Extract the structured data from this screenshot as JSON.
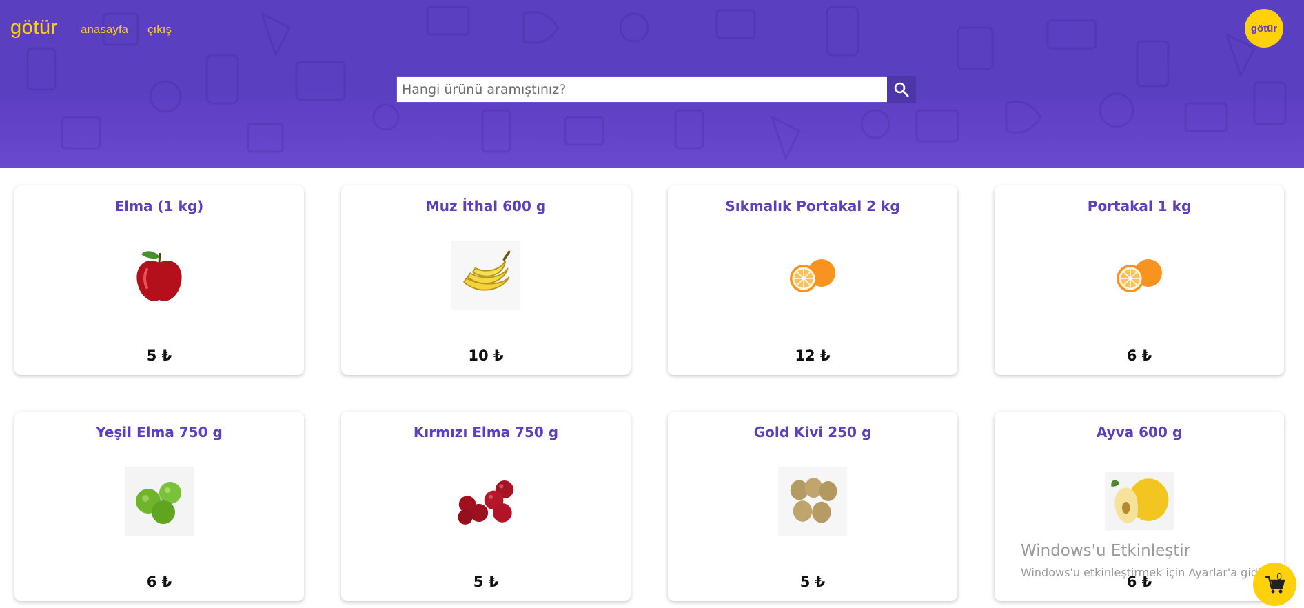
{
  "header": {
    "logo": "götür",
    "nav": {
      "home": "anasayfa",
      "logout": "çıkış"
    },
    "badge": "götür"
  },
  "search": {
    "placeholder": "Hangi ürünü aramıştınız?",
    "value": ""
  },
  "products": [
    {
      "name": "Elma (1 kg)",
      "price": "5 ₺",
      "image": "red-apple-icon"
    },
    {
      "name": "Muz İthal 600 g",
      "price": "10 ₺",
      "image": "banana-icon"
    },
    {
      "name": "Sıkmalık Portakal 2 kg",
      "price": "12 ₺",
      "image": "orange-icon"
    },
    {
      "name": "Portakal 1 kg",
      "price": "6 ₺",
      "image": "orange-icon"
    },
    {
      "name": "Yeşil Elma 750 g",
      "price": "6 ₺",
      "image": "green-apples-icon"
    },
    {
      "name": "Kırmızı Elma 750 g",
      "price": "5 ₺",
      "image": "red-apples-icon"
    },
    {
      "name": "Gold Kivi 250 g",
      "price": "5 ₺",
      "image": "kiwi-icon"
    },
    {
      "name": "Ayva 600 g",
      "price": "6 ₺",
      "image": "quince-icon"
    }
  ],
  "watermark": {
    "title": "Windows'u Etkinleştir",
    "subtitle": "Windows'u etkinleştirmek için Ayarlar'a gidin."
  },
  "cart": {
    "count": "0"
  },
  "colors": {
    "brand_purple": "#5d3ebc",
    "brand_yellow": "#ffd10d"
  }
}
